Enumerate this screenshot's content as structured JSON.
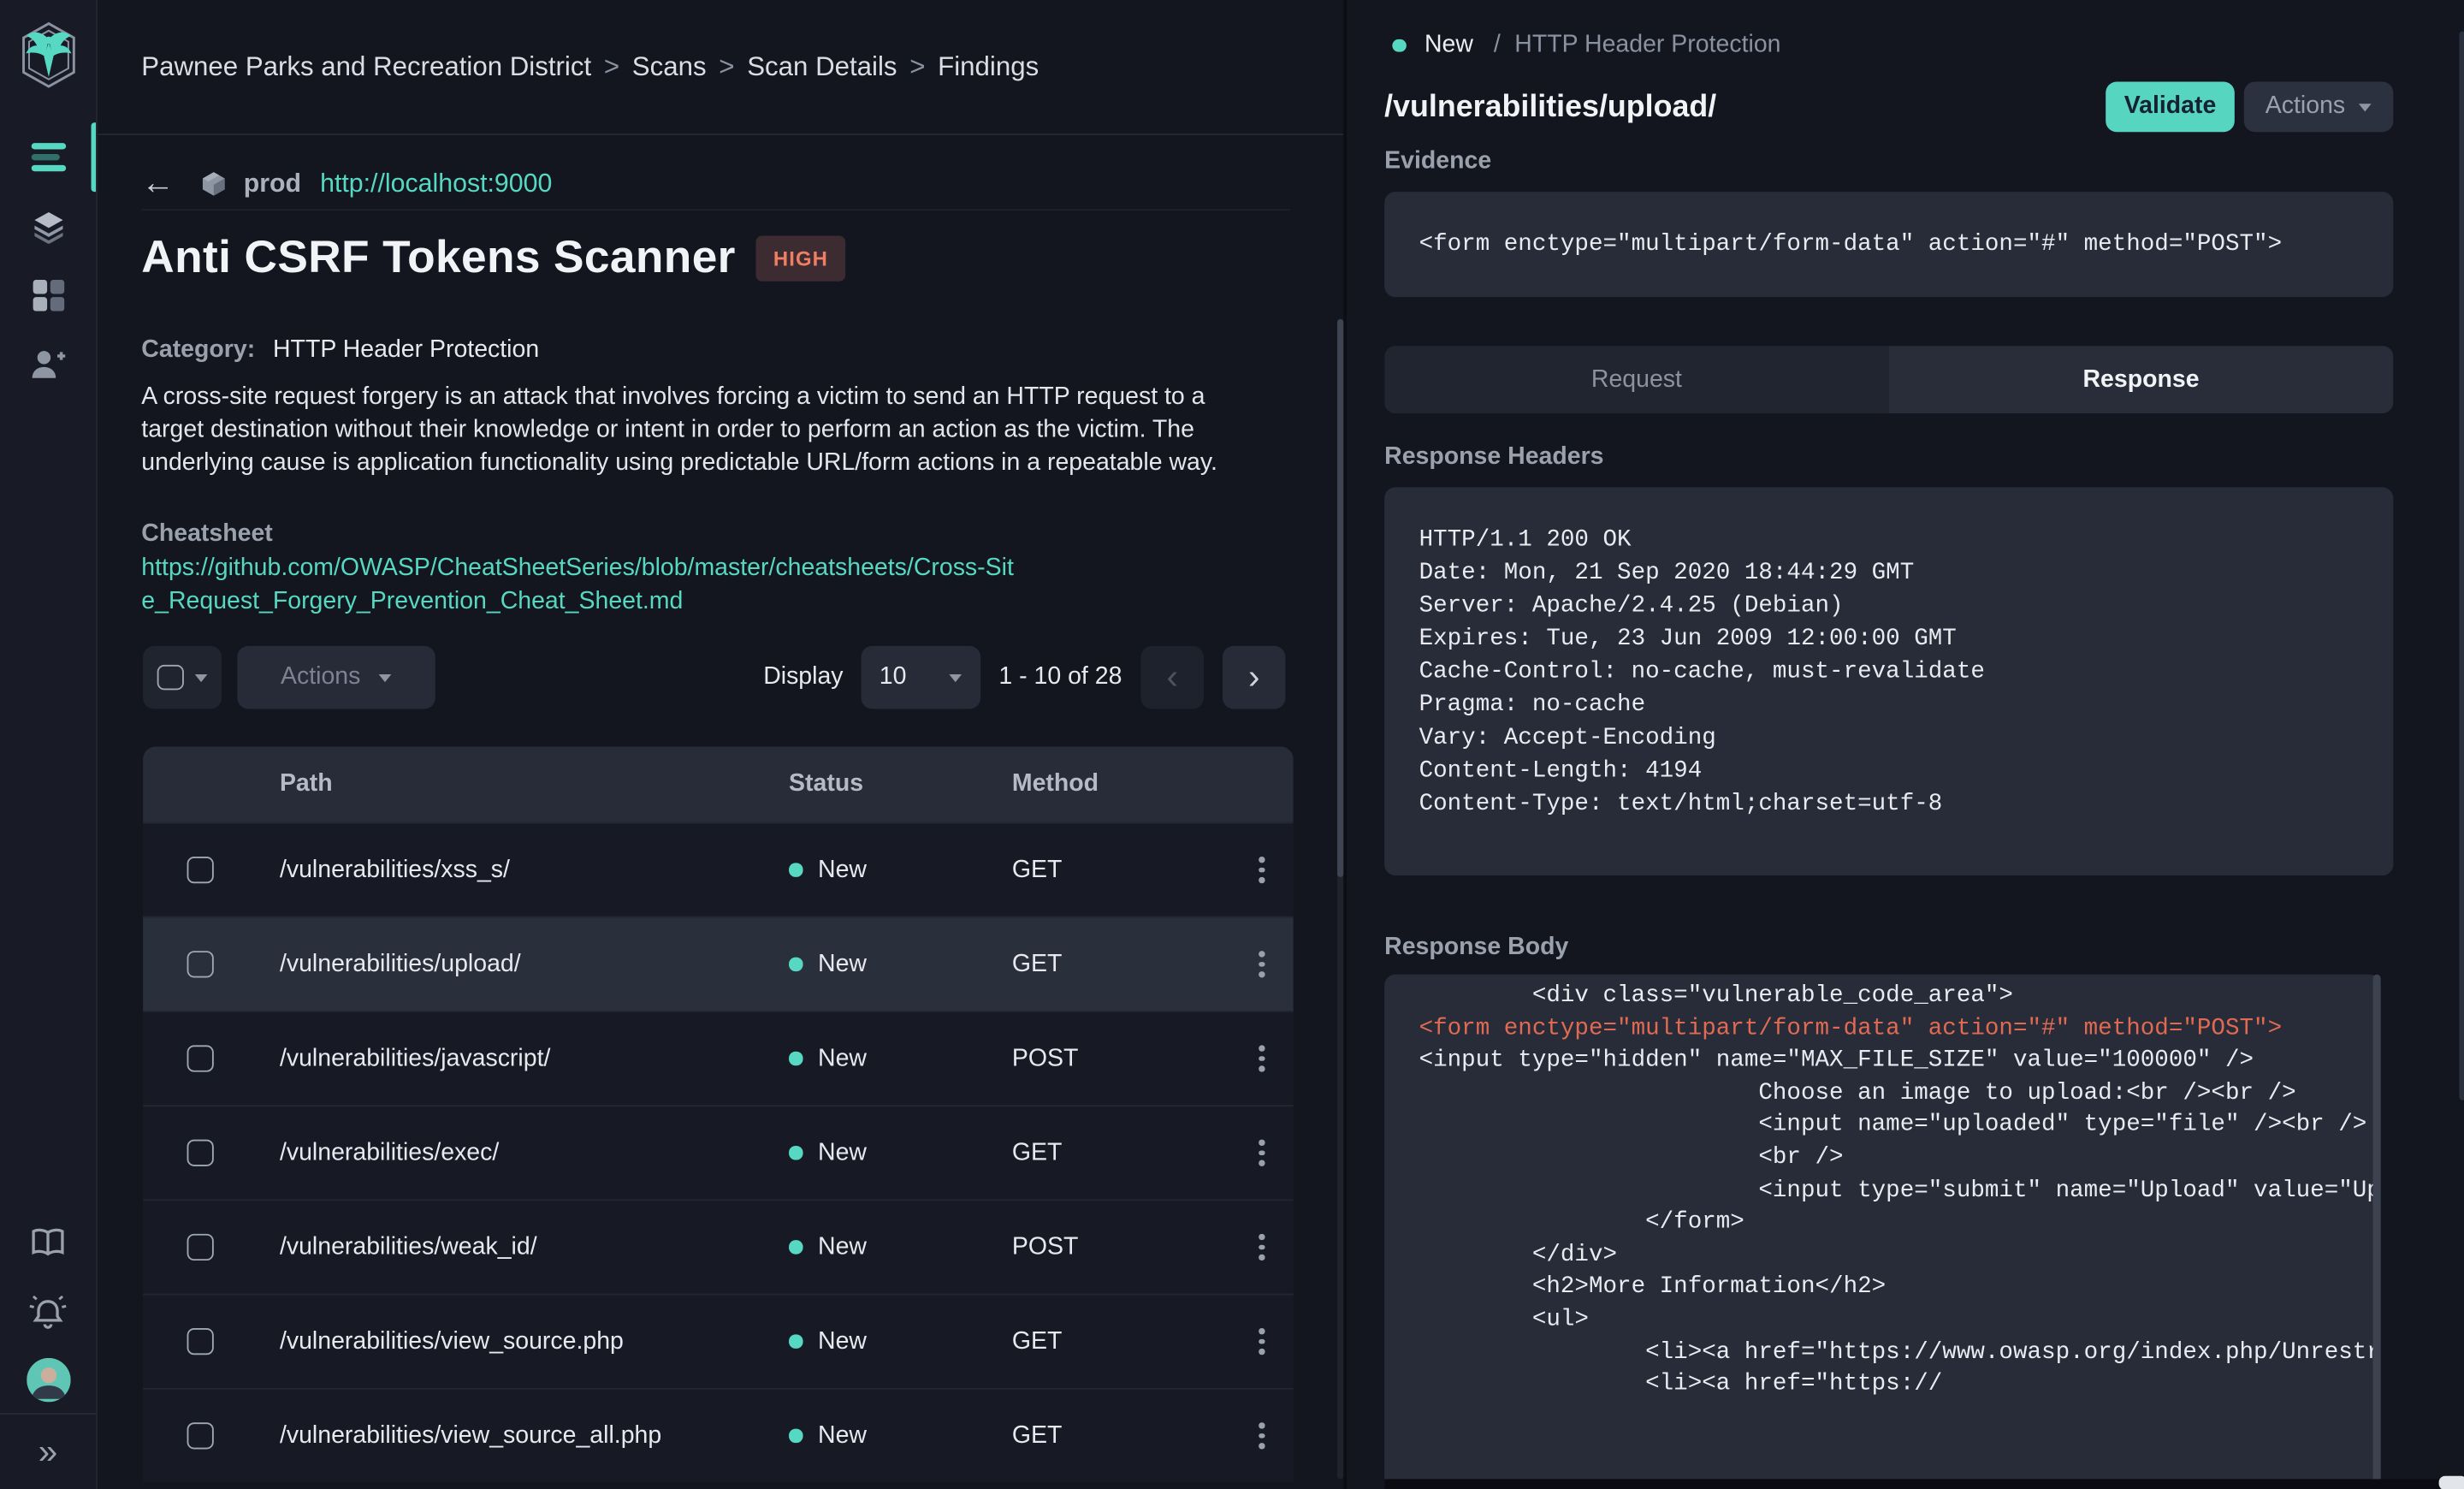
{
  "colors": {
    "accent_teal": "#56d8c2",
    "severity_high_text": "#ef7f63",
    "severity_high_bg": "#3c2b31",
    "code_highlight": "#e06a52",
    "validate_button": "#56d6c1"
  },
  "sidebar": {
    "icons": [
      "phoenix-logo",
      "menu",
      "layers",
      "dashboard-grid",
      "user-add",
      "book",
      "notifications-bell",
      "user-avatar",
      "collapse-chevrons"
    ],
    "collapse_glyph": "»"
  },
  "breadcrumb": {
    "separator": ">",
    "parts": [
      "Pawnee Parks and Recreation District",
      "Scans",
      "Scan Details",
      "Findings"
    ]
  },
  "scan": {
    "back_glyph": "←",
    "environment": "prod",
    "base_url": "http://localhost:9000",
    "scanner_title": "Anti CSRF Tokens Scanner",
    "severity": "HIGH",
    "category_label": "Category:",
    "category": "HTTP Header Protection",
    "description": "A cross-site request forgery is an attack that involves forcing a victim to send an HTTP request to a target destination without their knowledge or intent in order to perform an action as the victim. The underlying cause is application functionality using predictable URL/form actions in a repeatable way.",
    "cheatsheet_label": "Cheatsheet",
    "cheatsheet_url": "https://github.com/OWASP/CheatSheetSeries/blob/master/cheatsheets/Cross-Site_Request_Forgery_Prevention_Cheat_Sheet.md"
  },
  "toolbar": {
    "actions_label": "Actions",
    "display_label": "Display",
    "page_size": "10",
    "range_text": "1 - 10 of 28",
    "prev_glyph": "‹",
    "next_glyph": "›"
  },
  "table": {
    "columns": [
      "Path",
      "Status",
      "Method"
    ],
    "rows": [
      {
        "path": "/vulnerabilities/xss_s/",
        "status": "New",
        "method": "GET",
        "selected": false
      },
      {
        "path": "/vulnerabilities/upload/",
        "status": "New",
        "method": "GET",
        "selected": true
      },
      {
        "path": "/vulnerabilities/javascript/",
        "status": "New",
        "method": "POST",
        "selected": false
      },
      {
        "path": "/vulnerabilities/exec/",
        "status": "New",
        "method": "GET",
        "selected": false
      },
      {
        "path": "/vulnerabilities/weak_id/",
        "status": "New",
        "method": "POST",
        "selected": false
      },
      {
        "path": "/vulnerabilities/view_source.php",
        "status": "New",
        "method": "GET",
        "selected": false
      },
      {
        "path": "/vulnerabilities/view_source_all.php",
        "status": "New",
        "method": "GET",
        "selected": false
      }
    ]
  },
  "finding": {
    "status": "New",
    "status_separator": "/",
    "category": "HTTP Header Protection",
    "path": "/vulnerabilities/upload/",
    "validate_label": "Validate",
    "actions_label": "Actions",
    "evidence_label": "Evidence",
    "evidence": "<form enctype=\"multipart/form-data\" action=\"#\" method=\"POST\">",
    "tabs": [
      {
        "label": "Request",
        "active": false
      },
      {
        "label": "Response",
        "active": true
      }
    ],
    "response_headers_label": "Response Headers",
    "response_headers": [
      "HTTP/1.1 200 OK",
      "Date: Mon, 21 Sep 2020 18:44:29 GMT",
      "Server: Apache/2.4.25 (Debian)",
      "Expires: Tue, 23 Jun 2009 12:00:00 GMT",
      "Cache-Control: no-cache, must-revalidate",
      "Pragma: no-cache",
      "Vary: Accept-Encoding",
      "Content-Length: 4194",
      "Content-Type: text/html;charset=utf-8"
    ],
    "response_body_label": "Response Body",
    "response_body_lines": [
      {
        "text": "        <div class=\"vulnerable_code_area\">",
        "highlight": false
      },
      {
        "text": "<form enctype=\"multipart/form-data\" action=\"#\" method=\"POST\">",
        "highlight": true
      },
      {
        "text": "<input type=\"hidden\" name=\"MAX_FILE_SIZE\" value=\"100000\" />",
        "highlight": false
      },
      {
        "text": "                        Choose an image to upload:<br /><br />",
        "highlight": false
      },
      {
        "text": "                        <input name=\"uploaded\" type=\"file\" /><br />",
        "highlight": false
      },
      {
        "text": "                        <br />",
        "highlight": false
      },
      {
        "text": "                        <input type=\"submit\" name=\"Upload\" value=\"Upload\" />",
        "highlight": false
      },
      {
        "text": "",
        "highlight": false
      },
      {
        "text": "                </form>",
        "highlight": false
      },
      {
        "text": "",
        "highlight": false
      },
      {
        "text": "        </div>",
        "highlight": false
      },
      {
        "text": "",
        "highlight": false
      },
      {
        "text": "        <h2>More Information</h2>",
        "highlight": false
      },
      {
        "text": "        <ul>",
        "highlight": false
      },
      {
        "text": "                <li><a href=\"https://www.owasp.org/index.php/Unrestricted_File_Upload\">",
        "highlight": false
      },
      {
        "text": "                <li><a href=\"https://",
        "highlight": false
      }
    ]
  }
}
